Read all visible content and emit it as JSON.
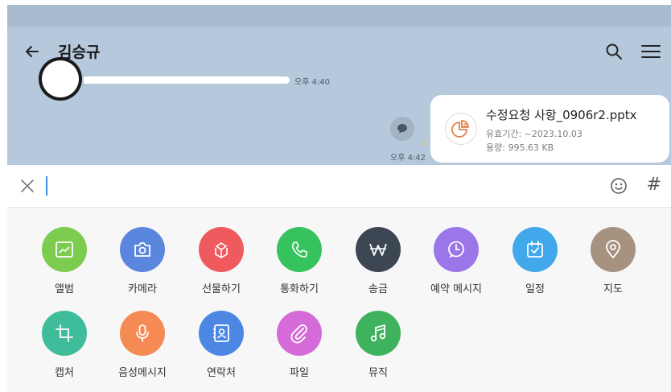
{
  "header": {
    "title": "김승규",
    "back_icon": "arrow-left-icon",
    "search_icon": "search-icon",
    "menu_icon": "hamburger-menu-icon"
  },
  "messages": {
    "first_time": "오후 4:40",
    "second_time": "오후 4:42",
    "unread_count": "1",
    "file": {
      "name": "수정요청 사항_0906r2.pptx",
      "expiry": "유효기간: ~2023.10.03",
      "size": "용량: 995.63 KB",
      "icon": "pie-chart-file-icon"
    }
  },
  "input": {
    "value": "",
    "emoji_icon": "emoji-icon",
    "hashtag_label": "#"
  },
  "tools": [
    {
      "label": "앨범",
      "icon": "image-icon",
      "color": "#7ccd4f"
    },
    {
      "label": "카메라",
      "icon": "camera-icon",
      "color": "#5b86dd"
    },
    {
      "label": "선물하기",
      "icon": "gift-icon",
      "color": "#ef5a5f"
    },
    {
      "label": "통화하기",
      "icon": "phone-icon",
      "color": "#36c25c"
    },
    {
      "label": "송금",
      "icon": "won-icon",
      "color": "#3d4653"
    },
    {
      "label": "예약 메시지",
      "icon": "clock-icon",
      "color": "#9a76e8"
    },
    {
      "label": "일정",
      "icon": "calendar-icon",
      "color": "#41a8ec"
    },
    {
      "label": "지도",
      "icon": "map-pin-icon",
      "color": "#a79280"
    },
    {
      "label": "캡처",
      "icon": "crop-icon",
      "color": "#3fbd9a"
    },
    {
      "label": "음성메시지",
      "icon": "microphone-icon",
      "color": "#f68a54"
    },
    {
      "label": "연락처",
      "icon": "contact-icon",
      "color": "#4b87e3"
    },
    {
      "label": "파일",
      "icon": "paperclip-icon",
      "color": "#d56bd8"
    },
    {
      "label": "뮤직",
      "icon": "music-icon",
      "color": "#3fb25d"
    }
  ]
}
